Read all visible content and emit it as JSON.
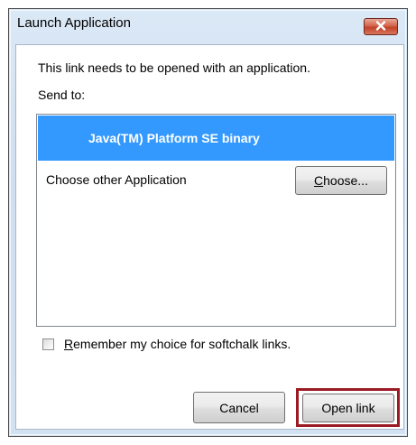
{
  "window": {
    "title": "Launch Application",
    "close_icon": "close-icon"
  },
  "dialog": {
    "message": "This link needs to be opened with an application.",
    "send_to_label": "Send to:"
  },
  "app_list": {
    "selected_app": "Java(TM) Platform SE binary",
    "other_app_label": "Choose other Application",
    "choose_button": {
      "mnemonic": "C",
      "rest": "hoose..."
    }
  },
  "remember_choice": {
    "checked": false,
    "mnemonic": "R",
    "rest": "emember my choice for softchalk links."
  },
  "buttons": {
    "cancel": "Cancel",
    "open_link": "Open link"
  },
  "colors": {
    "selection": "#3399ff",
    "highlight_border": "#9b1b24",
    "close_button": "#c24229"
  }
}
